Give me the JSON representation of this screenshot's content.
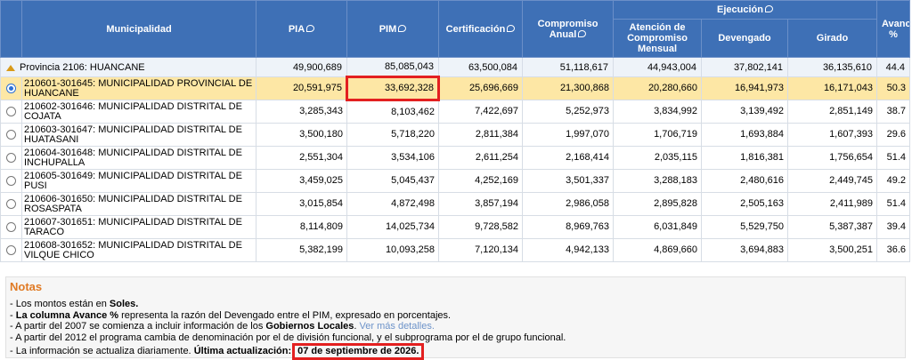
{
  "province": {
    "label": "Provincia 2106: HUANCANE",
    "values": [
      "49,900,689",
      "85,085,043",
      "63,500,084",
      "51,118,617",
      "44,943,004",
      "37,802,141",
      "36,135,610",
      "44.4"
    ]
  },
  "headers": {
    "municipalidad": "Municipalidad",
    "pia": "PIA",
    "pim": "PIM",
    "certificacion": "Certificación",
    "compromiso_anual": "Compromiso Anual",
    "ejecucion": "Ejecución",
    "atencion": "Atención de Compromiso Mensual",
    "devengado": "Devengado",
    "girado": "Girado",
    "avance": "Avance %"
  },
  "rows": [
    {
      "name": "210601-301645: MUNICIPALIDAD PROVINCIAL DE HUANCANE",
      "pia": "20,591,975",
      "pim": "33,692,328",
      "cert": "25,696,669",
      "comp": "21,300,868",
      "aten": "20,280,660",
      "dev": "16,941,973",
      "gir": "16,171,043",
      "avance": "50.3"
    },
    {
      "name": "210602-301646: MUNICIPALIDAD DISTRITAL DE COJATA",
      "pia": "3,285,343",
      "pim": "8,103,462",
      "cert": "7,422,697",
      "comp": "5,252,973",
      "aten": "3,834,992",
      "dev": "3,139,492",
      "gir": "2,851,149",
      "avance": "38.7"
    },
    {
      "name": "210603-301647: MUNICIPALIDAD DISTRITAL DE HUATASANI",
      "pia": "3,500,180",
      "pim": "5,718,220",
      "cert": "2,811,384",
      "comp": "1,997,070",
      "aten": "1,706,719",
      "dev": "1,693,884",
      "gir": "1,607,393",
      "avance": "29.6"
    },
    {
      "name": "210604-301648: MUNICIPALIDAD DISTRITAL DE INCHUPALLA",
      "pia": "2,551,304",
      "pim": "3,534,106",
      "cert": "2,611,254",
      "comp": "2,168,414",
      "aten": "2,035,115",
      "dev": "1,816,381",
      "gir": "1,756,654",
      "avance": "51.4"
    },
    {
      "name": "210605-301649: MUNICIPALIDAD DISTRITAL DE PUSI",
      "pia": "3,459,025",
      "pim": "5,045,437",
      "cert": "4,252,169",
      "comp": "3,501,337",
      "aten": "3,288,183",
      "dev": "2,480,616",
      "gir": "2,449,745",
      "avance": "49.2"
    },
    {
      "name": "210606-301650: MUNICIPALIDAD DISTRITAL DE ROSASPATA",
      "pia": "3,015,854",
      "pim": "4,872,498",
      "cert": "3,857,194",
      "comp": "2,986,058",
      "aten": "2,895,828",
      "dev": "2,505,163",
      "gir": "2,411,989",
      "avance": "51.4"
    },
    {
      "name": "210607-301651: MUNICIPALIDAD DISTRITAL DE TARACO",
      "pia": "8,114,809",
      "pim": "14,025,734",
      "cert": "9,728,582",
      "comp": "8,969,763",
      "aten": "6,031,849",
      "dev": "5,529,750",
      "gir": "5,387,387",
      "avance": "39.4"
    },
    {
      "name": "210608-301652: MUNICIPALIDAD DISTRITAL DE VILQUE CHICO",
      "pia": "5,382,199",
      "pim": "10,093,258",
      "cert": "7,120,134",
      "comp": "4,942,133",
      "aten": "4,869,660",
      "dev": "3,694,883",
      "gir": "3,500,251",
      "avance": "36.6"
    }
  ],
  "notes": {
    "title": "Notas",
    "n1_pre": "Los montos están en ",
    "n1_bold": "Soles.",
    "n2_bold": "La columna Avance %",
    "n2_rest": " representa la razón del Devengado entre el PIM, expresado en porcentajes.",
    "n3_pre": "A partir del 2007 se comienza a incluir información de los ",
    "n3_bold": "Gobiernos Locales",
    "n3_link": "Ver más detalles.",
    "n4": "A partir del 2012 el programa cambia de denominación por el de división funcional, y el subprograma por el de grupo funcional.",
    "n5_pre": "La información se actualiza diariamente. ",
    "n5_bold": "Última actualización:",
    "n5_date": "07 de septiembre de 2026."
  }
}
